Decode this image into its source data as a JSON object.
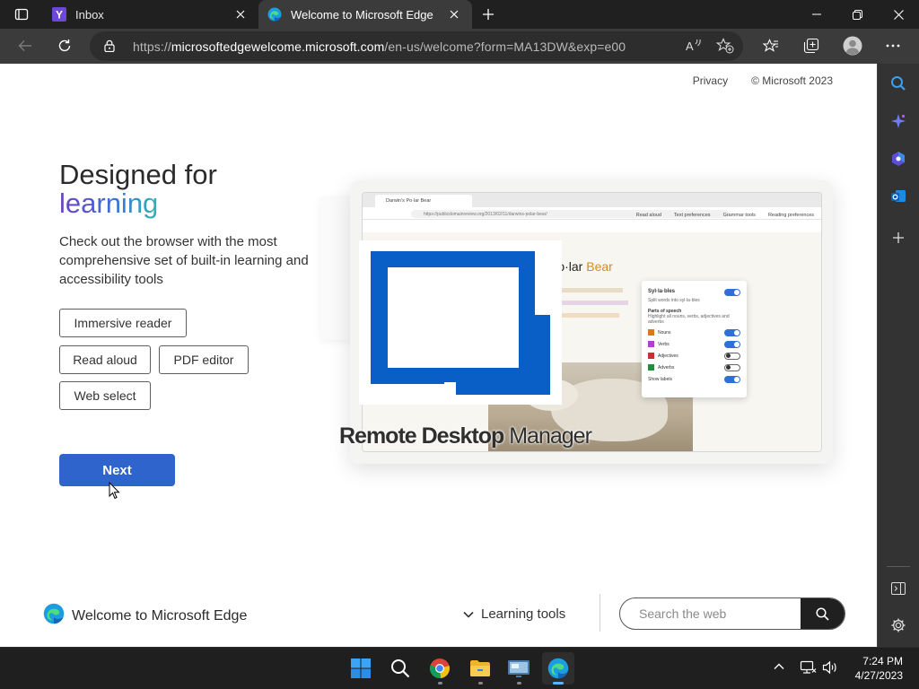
{
  "browser": {
    "tabs": [
      {
        "title": "Inbox",
        "icon": "yahoo-icon",
        "active": false
      },
      {
        "title": "Welcome to Microsoft Edge",
        "icon": "edge-icon",
        "active": true
      }
    ],
    "address": {
      "prefix": "https://",
      "host": "microsoftedgewelcome.microsoft.com",
      "path": "/en-us/welcome?form=MA13DW&exp=e00"
    }
  },
  "page": {
    "top_links": {
      "privacy": "Privacy",
      "copyright": "© Microsoft 2023"
    },
    "headline_line1": "Designed for",
    "headline_line2": "learning",
    "description": "Check out the browser with the most comprehensive set of built-in learning and accessibility tools",
    "features": [
      "Immersive reader",
      "Read aloud",
      "PDF editor",
      "Web select"
    ],
    "next_label": "Next",
    "illustration": {
      "tab_title": "Darwin's Po·lar Bear",
      "url": "https://publicdomainreview.org/2013/02/11/darwins-polar-bear/",
      "toolbar_items": [
        "Read aloud",
        "Text preferences",
        "Grammar tools",
        "Reading preferences"
      ],
      "article_title_a": "Po·lar",
      "article_title_b": "Bear",
      "grammar_panel": {
        "syllables": "Syl·la·bles",
        "syllables_sub": "Split words into syl·la·bles",
        "parts_heading": "Parts of speech",
        "parts_sub": "Highlight all nouns, verbs, adjectives and adverbs",
        "parts": [
          "Nouns",
          "Verbs",
          "Adjectives",
          "Adverbs"
        ],
        "show_labels": "Show labels"
      },
      "overlay_caption_bold": "Remote Desktop",
      "overlay_caption_light": "Manager"
    },
    "footer": {
      "title": "Welcome to Microsoft Edge",
      "learning_tools": "Learning tools",
      "search_placeholder": "Search the web"
    }
  },
  "taskbar": {
    "apps": [
      "start-icon",
      "search-icon",
      "chrome-icon",
      "file-explorer-icon",
      "remote-desktop-manager-icon",
      "edge-icon"
    ],
    "time": "7:24 PM",
    "date": "4/27/2023"
  },
  "colors": {
    "accent_blue": "#2f64cc",
    "rdm_blue": "#0a5fc6",
    "chrome_dark": "#202020",
    "toolbar": "#3b3b3b"
  }
}
